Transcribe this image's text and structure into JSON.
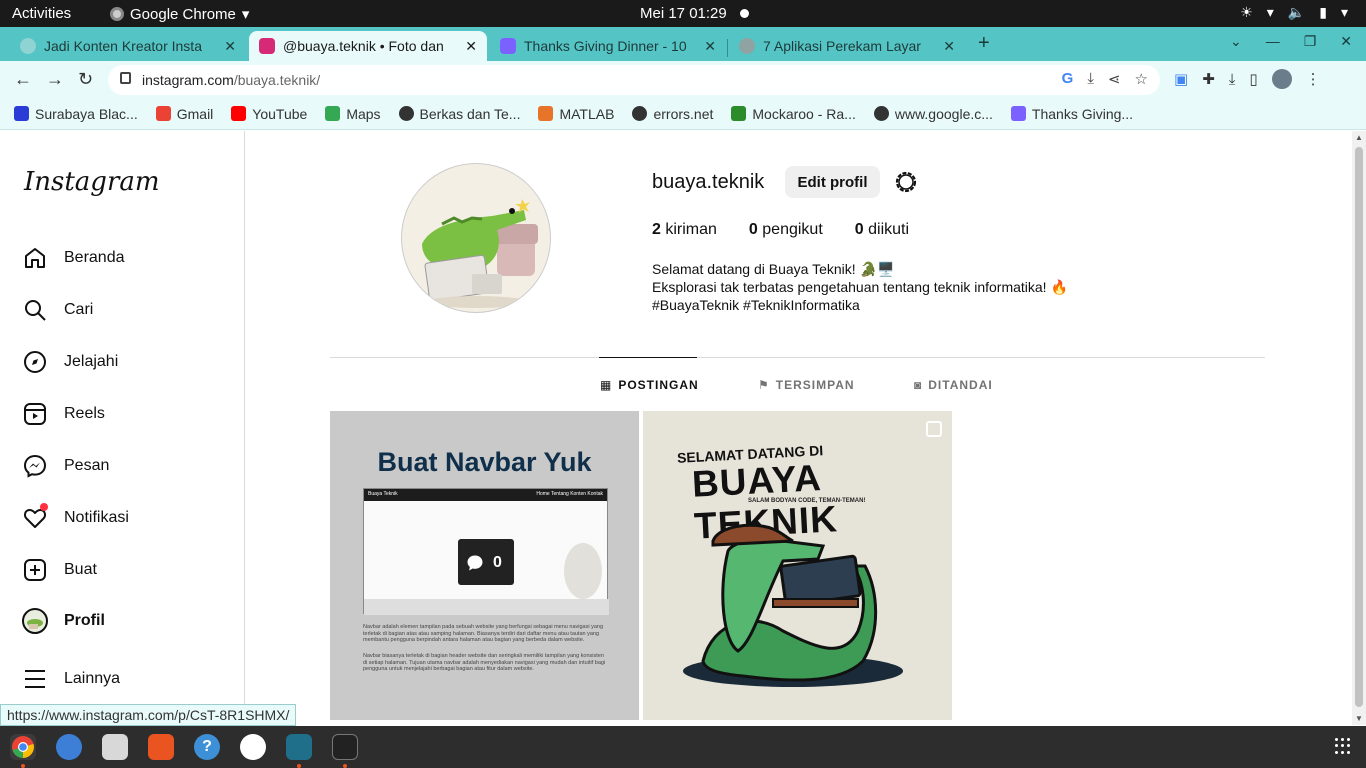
{
  "system_bar": {
    "activities": "Activities",
    "app_name": "Google Chrome",
    "clock": "Mei 17  01:29"
  },
  "browser": {
    "tabs": [
      {
        "title": "Jadi Konten Kreator Insta",
        "active": false,
        "favicon_color": "#8fd3d3"
      },
      {
        "title": "@buaya.teknik • Foto dan",
        "active": true,
        "favicon_color": "#d62976"
      },
      {
        "title": "Thanks Giving Dinner - 10",
        "active": false,
        "favicon_color": "#7b61ff"
      },
      {
        "title": "7 Aplikasi Perekam Layar",
        "active": false,
        "favicon_color": "#8fa3a3"
      }
    ],
    "new_tab": "+",
    "address": {
      "domain": "instagram.com",
      "path": "/buaya.teknik/"
    },
    "bookmarks": [
      {
        "label": "Surabaya Blac...",
        "icon_color": "#2a3bd6"
      },
      {
        "label": "Gmail",
        "icon_color": "#ea4335"
      },
      {
        "label": "YouTube",
        "icon_color": "#ff0000"
      },
      {
        "label": "Maps",
        "icon_color": "#34a853"
      },
      {
        "label": "Berkas dan Te...",
        "icon_color": "#333333"
      },
      {
        "label": "MATLAB",
        "icon_color": "#e8742a"
      },
      {
        "label": "errors.net",
        "icon_color": "#333333"
      },
      {
        "label": "Mockaroo - Ra...",
        "icon_color": "#2c8c2c"
      },
      {
        "label": "www.google.c...",
        "icon_color": "#333333"
      },
      {
        "label": "Thanks Giving...",
        "icon_color": "#7b61ff"
      }
    ],
    "status_url": "https://www.instagram.com/p/CsT-8R1SHMX/"
  },
  "instagram": {
    "logo": "Instagram",
    "nav": [
      {
        "label": "Beranda",
        "icon": "home-icon"
      },
      {
        "label": "Cari",
        "icon": "search-icon"
      },
      {
        "label": "Jelajahi",
        "icon": "compass-icon"
      },
      {
        "label": "Reels",
        "icon": "reels-icon"
      },
      {
        "label": "Pesan",
        "icon": "messenger-icon"
      },
      {
        "label": "Notifikasi",
        "icon": "heart-icon"
      },
      {
        "label": "Buat",
        "icon": "plus-square-icon"
      },
      {
        "label": "Profil",
        "icon": "avatar"
      },
      {
        "label": "Lainnya",
        "icon": "menu-icon"
      }
    ],
    "profile": {
      "username": "buaya.teknik",
      "edit_button": "Edit profil",
      "stats": {
        "posts_count": "2",
        "posts_label": "kiriman",
        "followers_count": "0",
        "followers_label": "pengikut",
        "following_count": "0",
        "following_label": "diikuti"
      },
      "bio": [
        "Selamat datang di Buaya Teknik! 🐊🖥️",
        "Eksplorasi tak terbatas pengetahuan tentang teknik informatika! 🔥",
        "#BuayaTeknik #TeknikInformatika"
      ]
    },
    "profile_tabs": [
      {
        "label": "POSTINGAN",
        "active": true
      },
      {
        "label": "TERSIMPAN",
        "active": false
      },
      {
        "label": "DITANDAI",
        "active": false
      }
    ],
    "posts": [
      {
        "heading": "Buat Navbar Yuk",
        "comment_count": "0",
        "mock_brand": "Buaya Teknik",
        "mock_links": "Home   Tentang   Konten   Kontak",
        "paragraph_1": "Navbar adalah elemen tampilan pada sebuah website yang berfungsi sebagai menu navigasi yang terletak di bagian atas atau samping halaman. Biasanya terdiri dari daftar menu atau tautan yang membantu pengguna berpindah antara halaman atau bagian yang berbeda dalam website.",
        "paragraph_2": "Navbar biasanya terletak di bagian header website dan seringkali memiliki tampilan yang konsisten di setiap halaman. Tujuan utama navbar adalah menyediakan navigasi yang mudah dan intuitif bagi pengguna untuk menjelajahi berbagai bagian atau fitur dalam website."
      },
      {
        "line1": "SELAMAT DATANG DI",
        "line2": "BUAYA TEKNIK",
        "line3": "SALAM BODYAN CODE, TEMAN-TEMAN!"
      }
    ]
  }
}
